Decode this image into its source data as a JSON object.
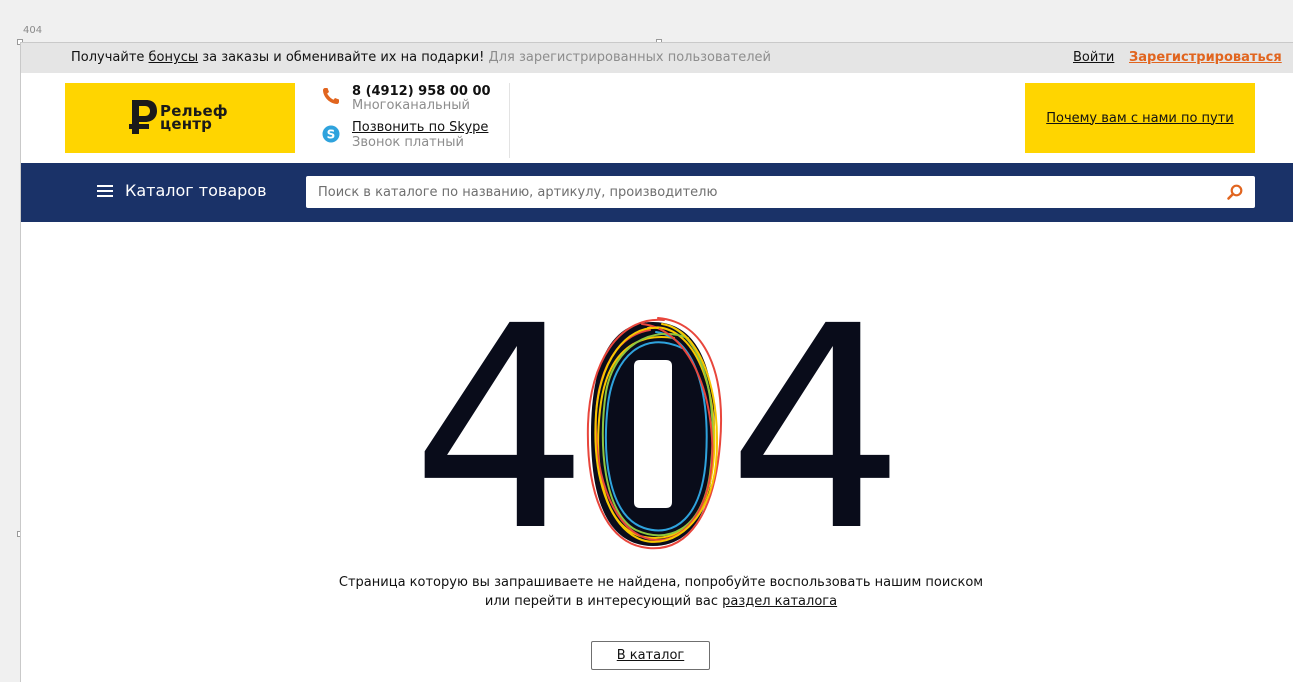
{
  "canvas": {
    "label": "404"
  },
  "topbar": {
    "promo_prefix": "Получайте ",
    "bonus_link": "бонусы",
    "promo_rest": " за заказы и обменивайте их на подарки! ",
    "promo_note": "Для зарегистрированных пользователей",
    "login": "Войти",
    "register": "Зарегистрироваться",
    "accent": "#e1651f"
  },
  "header": {
    "logo_line1": "Рельеф",
    "logo_line2": "центр",
    "phone": "8 (4912) 958 00 00",
    "phone_note": "Многоканальный",
    "skype_link": "Позвонить по Skype",
    "skype_note": "Звонок платный",
    "why_link": "Почему вам с нами по пути",
    "brand_color": "#ffd500"
  },
  "nav": {
    "catalog_label": "Каталог товаров",
    "search_placeholder": "Поиск в каталоге по названию, артикулу, производителю",
    "bar_color": "#1a3268"
  },
  "error": {
    "digit_left": "4",
    "digit_right": "4",
    "message_line1": "Страница которую вы запрашиваете не найдена, попробуйте воспользовать нашим поиском",
    "message_line2_prefix": "или перейти  в интересующий вас ",
    "message_link": "раздел каталога",
    "button": "В каталог"
  }
}
